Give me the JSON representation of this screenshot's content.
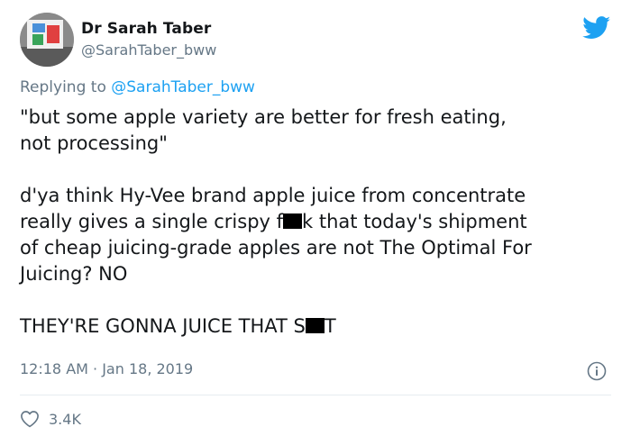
{
  "author": {
    "name": "Dr Sarah Taber",
    "handle": "@SarahTaber_bww"
  },
  "reply": {
    "prefix": "Replying to",
    "to": "@SarahTaber_bww"
  },
  "tweet": {
    "para1": "\"but some apple variety are better for fresh eating,\nnot processing\"",
    "para2_before": "d'ya think Hy-Vee brand apple juice from concentrate\nreally gives a single crispy f",
    "para2_after": "k that today's shipment\nof cheap juicing-grade apples are not The Optimal For\nJuicing? NO",
    "para3_before": "THEY'RE GONNA JUICE THAT S",
    "para3_after": "T"
  },
  "meta": {
    "timestamp": "12:18 AM · Jan 18, 2019"
  },
  "engagement": {
    "likes": "3.4K"
  },
  "icons": {
    "brand": "twitter-bird-icon",
    "info": "info-icon",
    "like": "heart-icon"
  },
  "colors": {
    "accent": "#1da1f2",
    "secondary_text": "#657786"
  }
}
